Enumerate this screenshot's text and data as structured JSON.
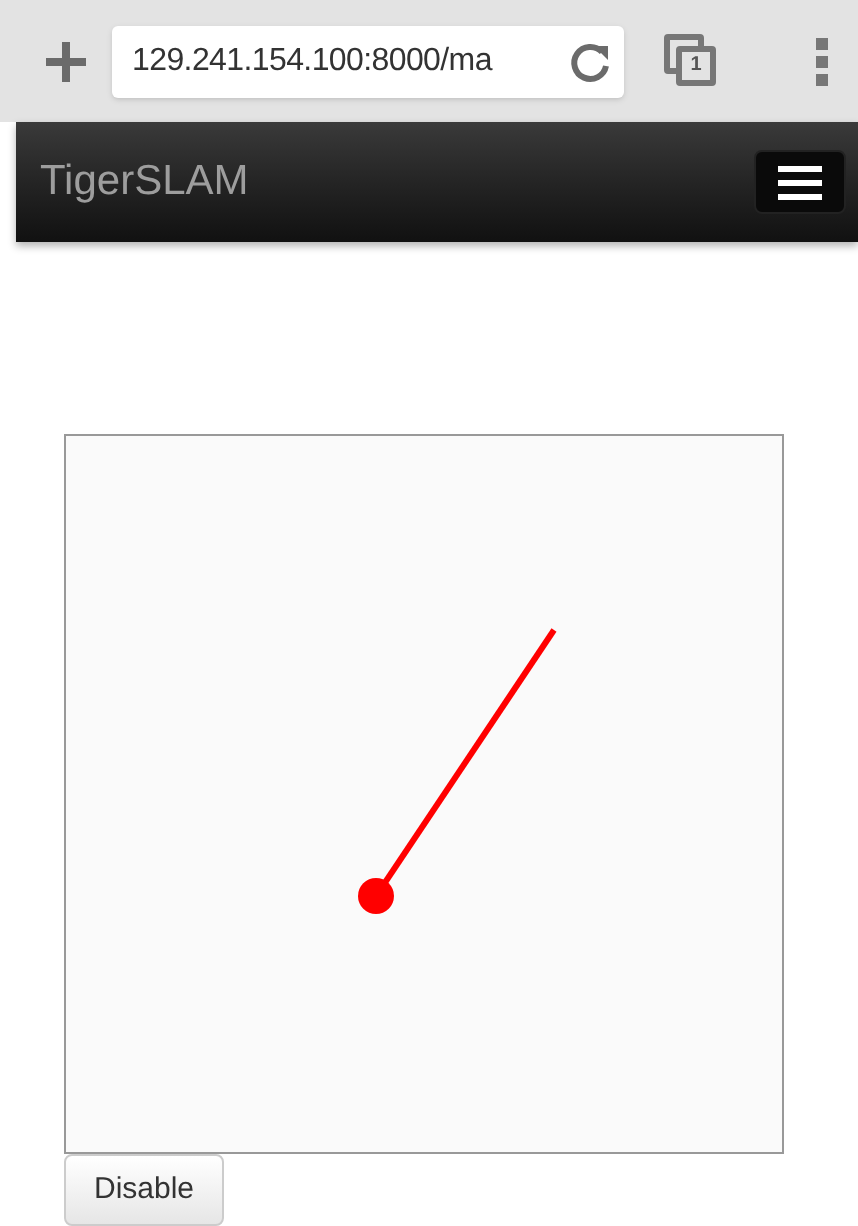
{
  "browser": {
    "url": "129.241.154.100:8000/ma",
    "tab_count": "1"
  },
  "navbar": {
    "brand": "TigerSLAM",
    "menu_expanded": false
  },
  "joystick": {
    "kind": "stick"
  },
  "buttons": [
    {
      "label": "Disable",
      "disabled": false
    }
  ]
}
